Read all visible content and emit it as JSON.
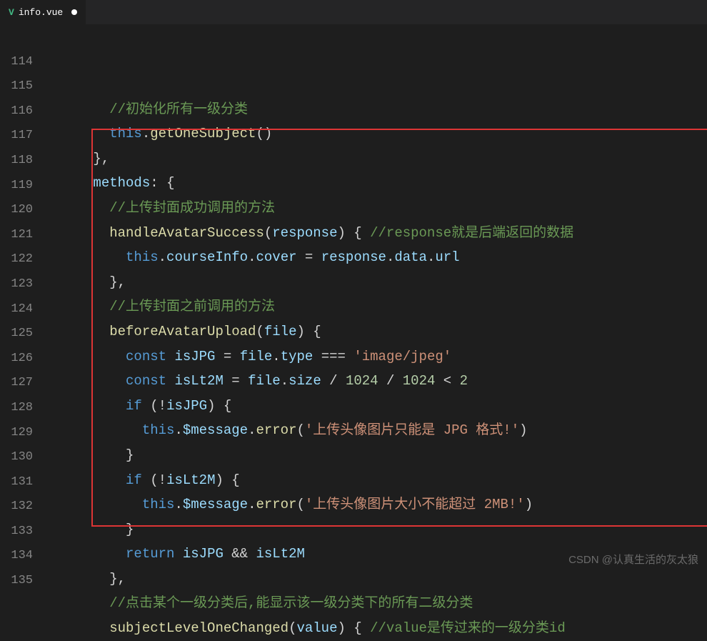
{
  "tab": {
    "filename": "info.vue",
    "modified": true
  },
  "line_start": 114,
  "code_lines": [
    {
      "n": "",
      "html": ""
    },
    {
      "n": "114",
      "html": "    <span class='c-comment'>//初始化所有一级分类</span>"
    },
    {
      "n": "115",
      "html": "    <span class='c-this'>this</span><span class='c-punct'>.</span><span class='c-func'>getOneSubject</span><span class='c-punct'>()</span>"
    },
    {
      "n": "116",
      "html": "  <span class='c-punct'>},</span>"
    },
    {
      "n": "117",
      "html": "  <span class='c-prop'>methods</span><span class='c-punct'>:</span> <span class='c-punct'>{</span>"
    },
    {
      "n": "118",
      "html": "    <span class='c-comment'>//上传封面成功调用的方法</span>"
    },
    {
      "n": "119",
      "html": "    <span class='c-func'>handleAvatarSuccess</span><span class='c-punct'>(</span><span class='c-param'>response</span><span class='c-punct'>)</span> <span class='c-punct'>{</span> <span class='c-comment'>//response就是后端返回的数据</span>"
    },
    {
      "n": "120",
      "html": "      <span class='c-this'>this</span><span class='c-punct'>.</span><span class='c-prop'>courseInfo</span><span class='c-punct'>.</span><span class='c-prop'>cover</span> <span class='c-op'>=</span> <span class='c-param'>response</span><span class='c-punct'>.</span><span class='c-prop'>data</span><span class='c-punct'>.</span><span class='c-prop'>url</span>"
    },
    {
      "n": "121",
      "html": "    <span class='c-punct'>},</span>"
    },
    {
      "n": "122",
      "html": "    <span class='c-comment'>//上传封面之前调用的方法</span>"
    },
    {
      "n": "123",
      "html": "    <span class='c-func'>beforeAvatarUpload</span><span class='c-punct'>(</span><span class='c-param'>file</span><span class='c-punct'>)</span> <span class='c-punct'>{</span>"
    },
    {
      "n": "124",
      "html": "      <span class='c-keyword'>const</span> <span class='c-prop'>isJPG</span> <span class='c-op'>=</span> <span class='c-param'>file</span><span class='c-punct'>.</span><span class='c-prop'>type</span> <span class='c-op'>===</span> <span class='c-string'>'image/jpeg'</span>"
    },
    {
      "n": "125",
      "html": "      <span class='c-keyword'>const</span> <span class='c-prop'>isLt2M</span> <span class='c-op'>=</span> <span class='c-param'>file</span><span class='c-punct'>.</span><span class='c-prop'>size</span> <span class='c-op'>/</span> <span class='c-number'>1024</span> <span class='c-op'>/</span> <span class='c-number'>1024</span> <span class='c-op'>&lt;</span> <span class='c-number'>2</span>"
    },
    {
      "n": "126",
      "html": "      <span class='c-keyword'>if</span> <span class='c-punct'>(</span><span class='c-op'>!</span><span class='c-prop'>isJPG</span><span class='c-punct'>)</span> <span class='c-punct'>{</span>"
    },
    {
      "n": "127",
      "html": "        <span class='c-this'>this</span><span class='c-punct'>.</span><span class='c-prop'>$message</span><span class='c-punct'>.</span><span class='c-func'>error</span><span class='c-punct'>(</span><span class='c-string'>'上传头像图片只能是 JPG 格式!'</span><span class='c-punct'>)</span>"
    },
    {
      "n": "128",
      "html": "      <span class='c-punct'>}</span>"
    },
    {
      "n": "129",
      "html": "      <span class='c-keyword'>if</span> <span class='c-punct'>(</span><span class='c-op'>!</span><span class='c-prop'>isLt2M</span><span class='c-punct'>)</span> <span class='c-punct'>{</span>"
    },
    {
      "n": "130",
      "html": "        <span class='c-this'>this</span><span class='c-punct'>.</span><span class='c-prop'>$message</span><span class='c-punct'>.</span><span class='c-func'>error</span><span class='c-punct'>(</span><span class='c-string'>'上传头像图片大小不能超过 2MB!'</span><span class='c-punct'>)</span>"
    },
    {
      "n": "131",
      "html": "      <span class='c-punct'>}</span>"
    },
    {
      "n": "132",
      "html": "      <span class='c-keyword'>return</span> <span class='c-prop'>isJPG</span> <span class='c-op'>&amp;&amp;</span> <span class='c-prop'>isLt2M</span>"
    },
    {
      "n": "133",
      "html": "    <span class='c-punct'>},</span>"
    },
    {
      "n": "134",
      "html": "    <span class='c-comment'>//点击某个一级分类后,能显示该一级分类下的所有二级分类</span>"
    },
    {
      "n": "135",
      "html": "    <span class='c-func'>subjectLevelOneChanged</span><span class='c-punct'>(</span><span class='c-param'>value</span><span class='c-punct'>)</span> <span class='c-punct'>{</span> <span class='c-comment'>//value是传过来的一级分类id</span>"
    }
  ],
  "watermark": "CSDN @认真生活的灰太狼"
}
